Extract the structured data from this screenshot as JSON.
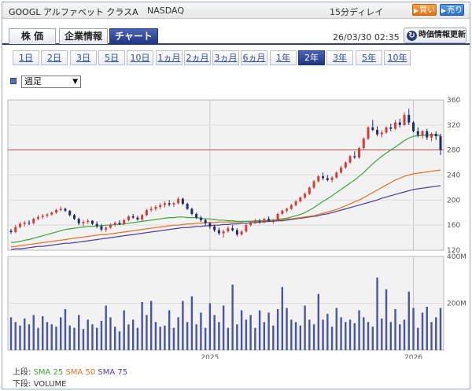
{
  "header": {
    "title": "GOOGL アルファベット クラスA",
    "market": "NASDAQ",
    "delay": "15分ディレイ",
    "buy_label": "買い",
    "sell_label": "売り"
  },
  "tabs": [
    {
      "label": "株 価",
      "active": false
    },
    {
      "label": "企業情報",
      "active": false
    },
    {
      "label": "チャート",
      "active": true
    }
  ],
  "timestamp": "26/03/30 02:35",
  "update_button": "時価情報更新",
  "periods": [
    {
      "label": "1日",
      "active": false
    },
    {
      "label": "2日",
      "active": false
    },
    {
      "label": "3日",
      "active": false
    },
    {
      "label": "5日",
      "active": false
    },
    {
      "label": "10日",
      "active": false
    },
    {
      "label": "1ヵ月",
      "active": false
    },
    {
      "label": "2ヵ月",
      "active": false
    },
    {
      "label": "3ヵ月",
      "active": false
    },
    {
      "label": "6ヵ月",
      "active": false
    },
    {
      "label": "1年",
      "active": false
    },
    {
      "label": "2年",
      "active": true
    },
    {
      "label": "3年",
      "active": false
    },
    {
      "label": "5年",
      "active": false
    },
    {
      "label": "10年",
      "active": false
    }
  ],
  "interval_select": {
    "value": "週足"
  },
  "legend": {
    "upper_label": "上段:",
    "sma25": "SMA 25",
    "sma50": "SMA 50",
    "sma75": "SMA 75",
    "lower_label": "下段:",
    "volume": "VOLUME"
  },
  "chart_data": {
    "type": "candlestick",
    "price_axis": {
      "ticks": [
        120,
        160,
        200,
        240,
        280,
        320,
        360
      ],
      "range": [
        120,
        360
      ]
    },
    "volume_axis": {
      "ticks": [
        "200M",
        "400M"
      ],
      "range": [
        0,
        400
      ]
    },
    "x_ticks": [
      "2025",
      "2026"
    ],
    "reference_line": 280,
    "colors": {
      "up": "#d23c3c",
      "down": "#1f2c6a",
      "sma25": "#3aa63a",
      "sma50": "#e07020",
      "sma75": "#4a3a9a",
      "volume": "#4a55a0",
      "reference": "#c0504d"
    },
    "candles": [
      [
        151,
        154,
        146,
        149
      ],
      [
        149,
        160,
        147,
        157
      ],
      [
        157,
        165,
        155,
        162
      ],
      [
        162,
        167,
        158,
        164
      ],
      [
        164,
        168,
        160,
        163
      ],
      [
        163,
        172,
        161,
        170
      ],
      [
        170,
        176,
        168,
        173
      ],
      [
        173,
        178,
        170,
        175
      ],
      [
        175,
        179,
        172,
        177
      ],
      [
        177,
        182,
        175,
        180
      ],
      [
        180,
        186,
        178,
        184
      ],
      [
        184,
        190,
        182,
        186
      ],
      [
        186,
        188,
        181,
        183
      ],
      [
        183,
        184,
        174,
        176
      ],
      [
        176,
        178,
        168,
        170
      ],
      [
        170,
        172,
        160,
        163
      ],
      [
        163,
        168,
        158,
        165
      ],
      [
        165,
        170,
        162,
        167
      ],
      [
        167,
        168,
        160,
        162
      ],
      [
        162,
        166,
        155,
        158
      ],
      [
        158,
        162,
        150,
        153
      ],
      [
        153,
        158,
        149,
        156
      ],
      [
        156,
        163,
        154,
        161
      ],
      [
        161,
        166,
        158,
        164
      ],
      [
        164,
        168,
        160,
        162
      ],
      [
        162,
        170,
        160,
        168
      ],
      [
        168,
        176,
        166,
        174
      ],
      [
        174,
        178,
        170,
        172
      ],
      [
        172,
        175,
        167,
        169
      ],
      [
        169,
        178,
        167,
        176
      ],
      [
        176,
        186,
        174,
        184
      ],
      [
        184,
        190,
        181,
        186
      ],
      [
        186,
        192,
        183,
        189
      ],
      [
        189,
        195,
        186,
        192
      ],
      [
        192,
        198,
        188,
        195
      ],
      [
        195,
        200,
        190,
        193
      ],
      [
        193,
        197,
        189,
        195
      ],
      [
        195,
        205,
        193,
        202
      ],
      [
        202,
        204,
        192,
        194
      ],
      [
        194,
        196,
        184,
        186
      ],
      [
        186,
        188,
        176,
        178
      ],
      [
        178,
        180,
        170,
        172
      ],
      [
        172,
        175,
        165,
        168
      ],
      [
        168,
        170,
        160,
        163
      ],
      [
        163,
        165,
        154,
        158
      ],
      [
        158,
        160,
        149,
        152
      ],
      [
        152,
        156,
        144,
        147
      ],
      [
        147,
        153,
        140,
        150
      ],
      [
        150,
        158,
        148,
        155
      ],
      [
        155,
        160,
        150,
        152
      ],
      [
        152,
        155,
        142,
        145
      ],
      [
        145,
        152,
        143,
        150
      ],
      [
        150,
        162,
        148,
        160
      ],
      [
        160,
        166,
        158,
        164
      ],
      [
        164,
        170,
        162,
        166
      ],
      [
        166,
        170,
        162,
        165
      ],
      [
        165,
        172,
        163,
        170
      ],
      [
        170,
        174,
        165,
        167
      ],
      [
        167,
        170,
        162,
        168
      ],
      [
        168,
        180,
        166,
        178
      ],
      [
        178,
        185,
        176,
        183
      ],
      [
        183,
        188,
        180,
        186
      ],
      [
        186,
        194,
        184,
        192
      ],
      [
        192,
        200,
        190,
        198
      ],
      [
        198,
        206,
        196,
        204
      ],
      [
        204,
        212,
        202,
        210
      ],
      [
        210,
        222,
        208,
        220
      ],
      [
        220,
        232,
        218,
        230
      ],
      [
        230,
        240,
        228,
        238
      ],
      [
        238,
        244,
        232,
        235
      ],
      [
        235,
        240,
        230,
        232
      ],
      [
        232,
        238,
        228,
        236
      ],
      [
        236,
        246,
        234,
        244
      ],
      [
        244,
        255,
        242,
        252
      ],
      [
        252,
        262,
        250,
        260
      ],
      [
        260,
        272,
        258,
        270
      ],
      [
        270,
        278,
        266,
        268
      ],
      [
        268,
        285,
        266,
        283
      ],
      [
        283,
        300,
        281,
        298
      ],
      [
        298,
        318,
        296,
        316
      ],
      [
        316,
        328,
        310,
        312
      ],
      [
        312,
        318,
        302,
        305
      ],
      [
        305,
        312,
        300,
        308
      ],
      [
        308,
        318,
        306,
        316
      ],
      [
        316,
        322,
        310,
        314
      ],
      [
        314,
        328,
        312,
        324
      ],
      [
        324,
        330,
        316,
        320
      ],
      [
        320,
        340,
        318,
        336
      ],
      [
        336,
        346,
        320,
        324
      ],
      [
        324,
        326,
        308,
        310
      ],
      [
        310,
        316,
        300,
        304
      ],
      [
        304,
        312,
        298,
        310
      ],
      [
        310,
        314,
        296,
        300
      ],
      [
        300,
        308,
        294,
        306
      ],
      [
        306,
        310,
        296,
        302
      ],
      [
        302,
        306,
        272,
        280
      ]
    ],
    "sma25": [
      132,
      133,
      134,
      136,
      137,
      139,
      141,
      143,
      145,
      147,
      149,
      151,
      153,
      154,
      155,
      156,
      157,
      158,
      158,
      159,
      159,
      160,
      160,
      161,
      161,
      162,
      163,
      164,
      165,
      166,
      167,
      168,
      169,
      170,
      171,
      172,
      172,
      173,
      173,
      172,
      172,
      172,
      171,
      170,
      170,
      169,
      168,
      168,
      167,
      167,
      166,
      166,
      166,
      166,
      167,
      167,
      167,
      168,
      168,
      169,
      170,
      171,
      173,
      175,
      177,
      180,
      184,
      188,
      193,
      198,
      202,
      207,
      212,
      217,
      222,
      227,
      232,
      238,
      244,
      251,
      258,
      264,
      270,
      275,
      280,
      285,
      290,
      295,
      299,
      302,
      303,
      303,
      304,
      304,
      304,
      303
    ],
    "sma50": [
      125,
      126,
      127,
      128,
      129,
      130,
      131,
      132,
      133,
      134,
      135,
      136,
      137,
      138,
      139,
      140,
      141,
      142,
      143,
      144,
      145,
      145,
      146,
      147,
      148,
      149,
      150,
      151,
      152,
      153,
      154,
      155,
      156,
      157,
      158,
      159,
      160,
      160,
      161,
      162,
      162,
      163,
      163,
      164,
      164,
      164,
      165,
      165,
      165,
      165,
      165,
      165,
      166,
      166,
      166,
      166,
      167,
      167,
      168,
      168,
      169,
      170,
      170,
      171,
      172,
      173,
      174,
      175,
      177,
      179,
      181,
      183,
      185,
      188,
      191,
      194,
      197,
      200,
      204,
      208,
      212,
      216,
      220,
      224,
      228,
      232,
      235,
      238,
      240,
      242,
      243,
      244,
      245,
      246,
      247,
      248
    ],
    "sma75": [
      121,
      122,
      122,
      123,
      124,
      125,
      126,
      126,
      127,
      128,
      129,
      130,
      131,
      131,
      132,
      133,
      134,
      135,
      136,
      137,
      138,
      139,
      140,
      141,
      142,
      143,
      144,
      145,
      146,
      147,
      148,
      149,
      150,
      151,
      152,
      153,
      154,
      155,
      156,
      156,
      157,
      158,
      158,
      159,
      159,
      160,
      160,
      161,
      161,
      162,
      162,
      163,
      163,
      164,
      164,
      165,
      165,
      166,
      166,
      167,
      167,
      168,
      169,
      170,
      171,
      172,
      173,
      174,
      175,
      177,
      178,
      180,
      182,
      184,
      186,
      188,
      190,
      192,
      194,
      196,
      198,
      200,
      203,
      205,
      207,
      209,
      211,
      213,
      215,
      217,
      218,
      219,
      220,
      221,
      222,
      223
    ],
    "volume": [
      140,
      120,
      105,
      135,
      110,
      150,
      95,
      145,
      120,
      110,
      100,
      140,
      175,
      105,
      95,
      150,
      90,
      130,
      110,
      95,
      125,
      190,
      140,
      100,
      80,
      170,
      110,
      130,
      95,
      205,
      150,
      210,
      120,
      100,
      105,
      170,
      95,
      140,
      210,
      120,
      230,
      110,
      160,
      95,
      200,
      150,
      120,
      190,
      95,
      280,
      110,
      170,
      130,
      150,
      95,
      170,
      120,
      160,
      105,
      175,
      270,
      180,
      130,
      120,
      105,
      190,
      130,
      110,
      240,
      130,
      155,
      100,
      180,
      140,
      120,
      130,
      115,
      170,
      140,
      120,
      100,
      310,
      135,
      260,
      120,
      175,
      110,
      130,
      250,
      180,
      95,
      160,
      185,
      120,
      140,
      180
    ]
  }
}
